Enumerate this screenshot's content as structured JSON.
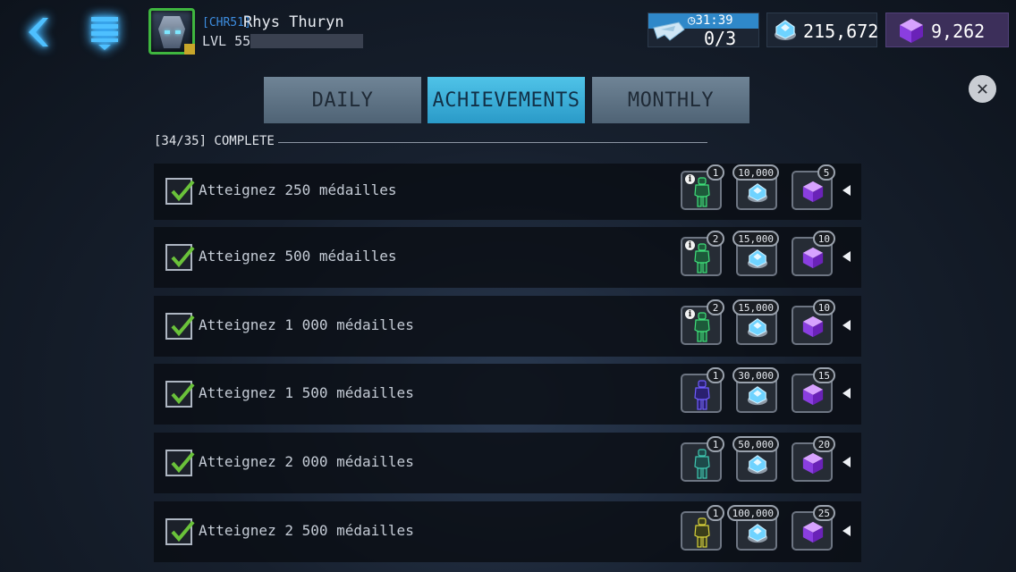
{
  "header": {
    "player_tag": "[CHR51]",
    "player_name": "Rhys Thuryn",
    "level_text": "LVL 55",
    "energy_timer": "31:39",
    "energy_count": "0/3",
    "credits": "215,672",
    "gems": "9,262"
  },
  "tabs": [
    {
      "label": "DAILY",
      "active": false
    },
    {
      "label": "ACHIEVEMENTS",
      "active": true
    },
    {
      "label": "MONTHLY",
      "active": false
    }
  ],
  "progress": {
    "label": "[34/35] COMPLETE"
  },
  "colors": {
    "accent": "#3fb8e6",
    "gem": "#8a3ee0",
    "check": "#6ac23a",
    "avatar_border": "#3fb63f"
  },
  "achievements": [
    {
      "label": "Atteignez 250 médailles",
      "bot_qty": "1",
      "credits": "10,000",
      "gems": "5",
      "bot_color": "green",
      "bot_info": true
    },
    {
      "label": "Atteignez 500 médailles",
      "bot_qty": "2",
      "credits": "15,000",
      "gems": "10",
      "bot_color": "green",
      "bot_info": true
    },
    {
      "label": "Atteignez 1 000 médailles",
      "bot_qty": "2",
      "credits": "15,000",
      "gems": "10",
      "bot_color": "green",
      "bot_info": true
    },
    {
      "label": "Atteignez 1 500 médailles",
      "bot_qty": "1",
      "credits": "30,000",
      "gems": "15",
      "bot_color": "purple",
      "bot_info": false
    },
    {
      "label": "Atteignez 2 000 médailles",
      "bot_qty": "1",
      "credits": "50,000",
      "gems": "20",
      "bot_color": "teal",
      "bot_info": false
    },
    {
      "label": "Atteignez 2 500 médailles",
      "bot_qty": "1",
      "credits": "100,000",
      "gems": "25",
      "bot_color": "yellow",
      "bot_info": false
    }
  ]
}
